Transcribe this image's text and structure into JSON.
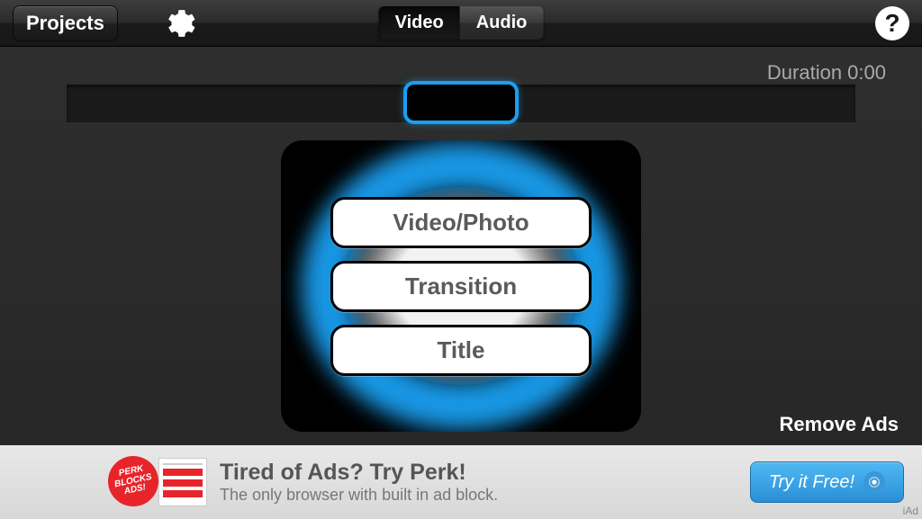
{
  "toolbar": {
    "projects_label": "Projects",
    "tabs": {
      "video": "Video",
      "audio": "Audio",
      "active": "video"
    }
  },
  "main": {
    "duration_label": "Duration 0:00",
    "actions": {
      "video_photo": "Video/Photo",
      "transition": "Transition",
      "title": "Title"
    },
    "remove_ads": "Remove Ads"
  },
  "ad": {
    "badge_line1": "PERK",
    "badge_line2": "BLOCKS",
    "badge_line3": "ADS!",
    "title": "Tired of Ads? Try Perk!",
    "subtitle": "The only browser with built in ad block.",
    "cta_label": "Try it Free!",
    "tag": "iAd"
  }
}
